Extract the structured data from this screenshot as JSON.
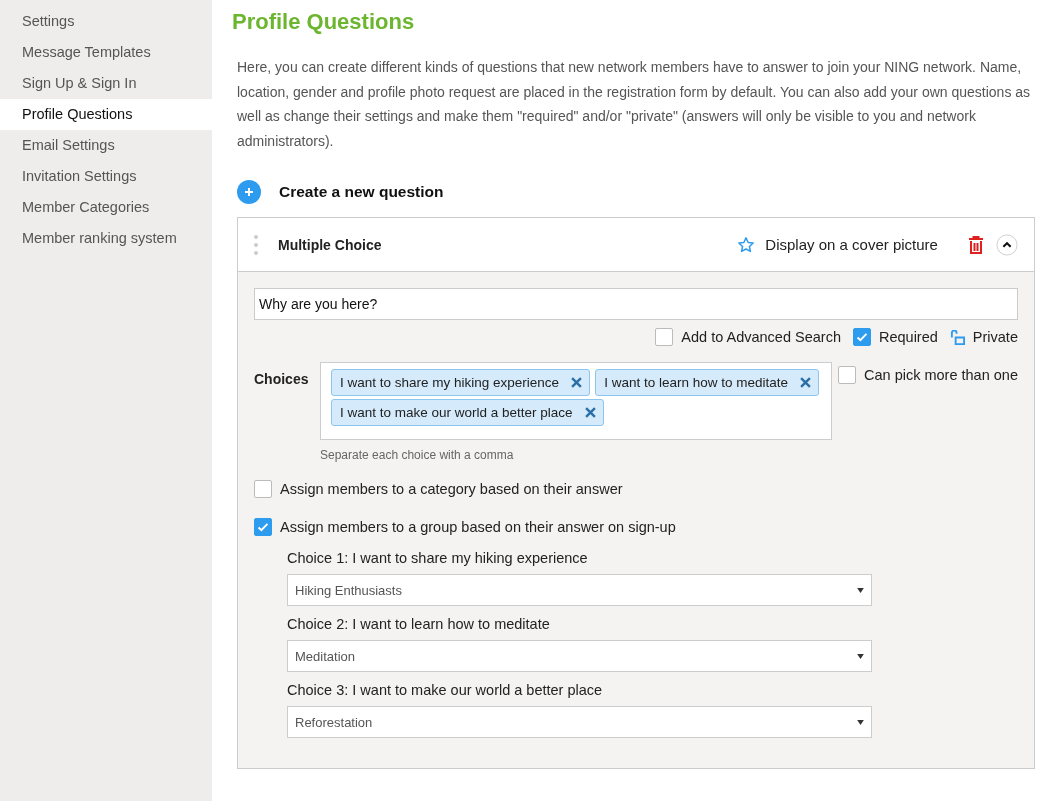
{
  "sidebar": {
    "items": [
      {
        "label": "Settings",
        "selected": false
      },
      {
        "label": "Message Templates",
        "selected": false
      },
      {
        "label": "Sign Up & Sign In",
        "selected": false
      },
      {
        "label": "Profile Questions",
        "selected": true
      },
      {
        "label": "Email Settings",
        "selected": false
      },
      {
        "label": "Invitation Settings",
        "selected": false
      },
      {
        "label": "Member Categories",
        "selected": false
      },
      {
        "label": "Member ranking system",
        "selected": false
      }
    ]
  },
  "page_title": "Profile Questions",
  "description": "Here, you can create different kinds of questions that new network members have to answer to join your NING network. Name, location, gender and profile photo request are placed in the registration form by default. You can also add your own questions as well as change their settings and make them \"required\" and/or \"private\" (answers will only be visible to you and network administrators).",
  "create_question": {
    "label": "Create a new question"
  },
  "question": {
    "type_label": "Multiple Choice",
    "cover_picture": {
      "label": "Display on a cover picture",
      "starred": false
    },
    "expanded": true,
    "question_text": "Why are you here?",
    "options": [
      {
        "kind": "checkbox",
        "label": "Add to Advanced Search",
        "checked": false
      },
      {
        "kind": "checkbox",
        "label": "Required",
        "checked": true
      },
      {
        "kind": "lock",
        "label": "Private",
        "locked": false
      }
    ],
    "choices_label": "Choices",
    "choices": [
      "I want to share my hiking experience",
      "I want to learn how to meditate",
      "I want to make our world a better place"
    ],
    "choices_hint": "Separate each choice with a comma",
    "multi_pick": {
      "label": "Can pick more than one",
      "checked": false
    },
    "category_assign": {
      "label": "Assign members to a category based on their answer",
      "checked": false
    },
    "group_assign": {
      "label": "Assign members to a group based on their answer on sign-up",
      "checked": true,
      "mappings": [
        {
          "label": "Choice 1: I want to share my hiking experience",
          "value": "Hiking Enthusiasts"
        },
        {
          "label": "Choice 2: I want to learn how to meditate",
          "value": "Meditation"
        },
        {
          "label": "Choice 3: I want to make our world a better place",
          "value": "Reforestation"
        }
      ]
    }
  }
}
